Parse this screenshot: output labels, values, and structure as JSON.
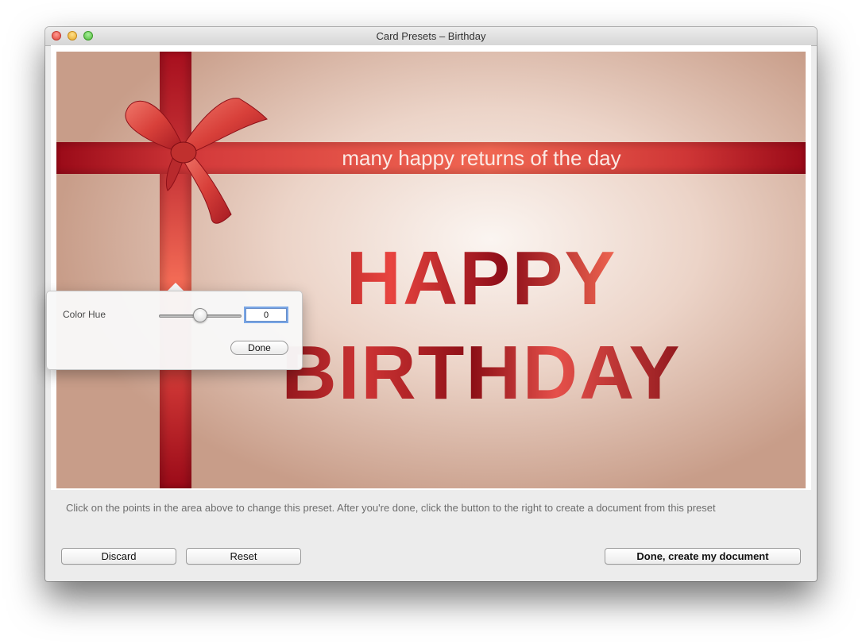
{
  "window": {
    "title": "Card Presets – Birthday"
  },
  "card": {
    "ribbon_text": "many happy returns of the day",
    "headline_line1": "HAPPY",
    "headline_line2": "BIRTHDAY"
  },
  "instruction": "Click on the points in the area above to change this preset. After you're done, click the button to the right to create a document from this preset",
  "buttons": {
    "discard": "Discard",
    "reset": "Reset",
    "done_create": "Done, create my document"
  },
  "popover": {
    "label": "Color Hue",
    "value": "0",
    "slider_level": 0.5,
    "done": "Done"
  },
  "colors": {
    "ribbon_red": "#c93232",
    "text_dark_red": "#8b0e14",
    "window_bg": "#ececec",
    "focus_ring": "#7aa7e6"
  }
}
